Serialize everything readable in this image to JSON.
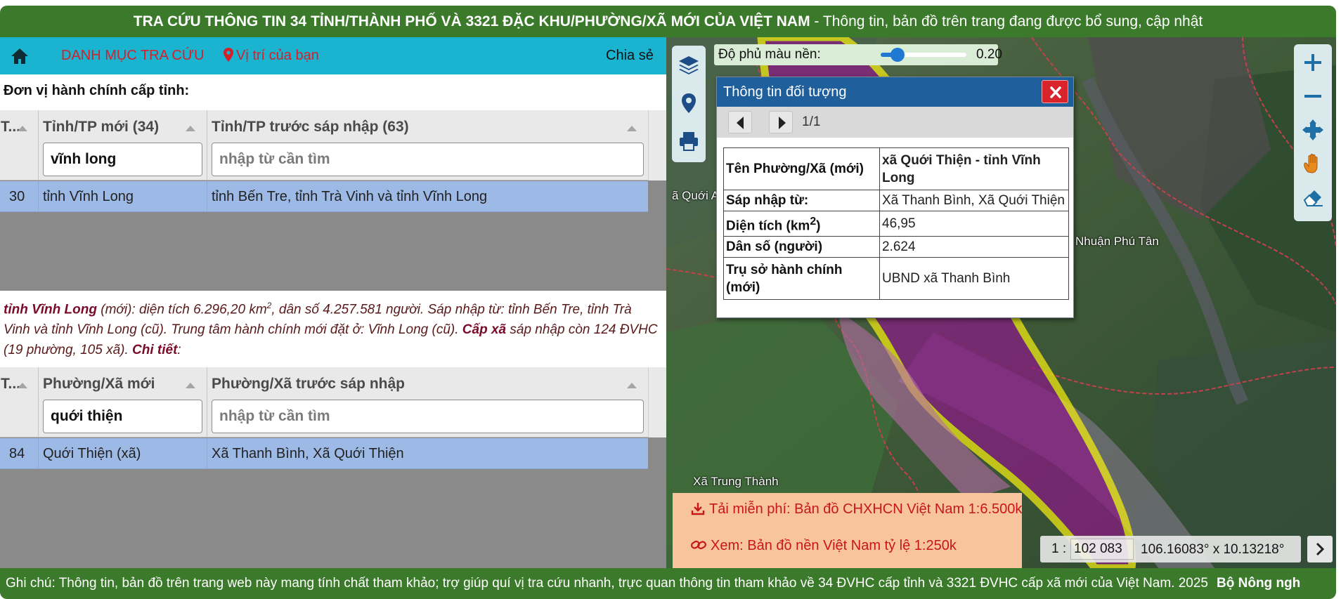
{
  "header": {
    "title": "TRA CỨU THÔNG TIN 34 TỈNH/THÀNH PHỐ VÀ 3321 ĐẶC KHU/PHƯỜNG/XÃ MỚI CỦA VIỆT NAM",
    "subtitle": " - Thông tin, bản đồ trên trang đang được bổ sung, cập nhật"
  },
  "nav": {
    "home_icon": "home-icon",
    "catalog": "DANH MỤC TRA CỨU",
    "location": "Vị trí của bạn",
    "share": "Chia sẻ"
  },
  "province_section": {
    "title": "Đơn vị hành chính cấp tỉnh:",
    "columns": [
      "T...",
      "Tỉnh/TP mới (34)",
      "Tỉnh/TP trước sáp nhập (63)"
    ],
    "filter_new_value": "vĩnh long",
    "filter_old_placeholder": "nhập từ cần tìm",
    "rows": [
      {
        "stt": "30",
        "new": "tỉnh Vĩnh Long",
        "old": "tỉnh Bến Tre, tỉnh Trà Vinh và tỉnh Vĩnh Long"
      }
    ]
  },
  "province_summary": {
    "name": "tỉnh Vĩnh Long",
    "text1": " (mới): diện tích 6.296,20 km",
    "sup": "2",
    "text2": ", dân số 4.257.581 người. Sáp nhập từ: tỉnh Bến Tre, tỉnh Trà Vinh và tỉnh Vĩnh Long (cũ). Trung tâm hành chính mới đặt ở: Vĩnh Long (cũ). ",
    "level_label": "Cấp xã",
    "text3": " sáp nhập còn 124 ĐVHC (19 phường, 105 xã). ",
    "detail_label": "Chi tiết",
    "text4": ":"
  },
  "commune_section": {
    "columns": [
      "T...",
      "Phường/Xã mới",
      "Phường/Xã trước sáp nhập"
    ],
    "filter_new_value": "quới thiện",
    "filter_old_placeholder": "nhập từ cần tìm",
    "rows": [
      {
        "stt": "84",
        "new": "Quới Thiện (xã)",
        "old": "Xã Thanh Bình, Xã Quới Thiện"
      }
    ]
  },
  "map": {
    "opacity_label": "Độ phủ màu nền:",
    "opacity_value": "0.20",
    "opacity_level": 0.2,
    "labels": [
      "ã Quới A",
      "Nhuận Phú Tân",
      "Xã Trung Thành"
    ],
    "left_tools": [
      "layers-icon",
      "map-pin-icon",
      "printer-icon"
    ],
    "right_tools": [
      "zoom-in-icon",
      "zoom-out-icon",
      "pan-arrows-icon",
      "hand-icon",
      "eraser-icon"
    ],
    "colors": {
      "highlight": "#8b1a86",
      "boundary": "#f5ee12",
      "admin_border": "#c3414a"
    }
  },
  "popup": {
    "title": "Thông tin đối tượng",
    "page": "1/1",
    "rows": [
      {
        "key": "Tên Phường/Xã (mới)",
        "value": "xã Quới Thiện - tỉnh Vĩnh Long"
      },
      {
        "key": "Sáp nhập từ:",
        "value": "Xã Thanh Bình, Xã Quới Thiện"
      },
      {
        "key": "Diện tích (km",
        "key_sup": "2",
        "key_tail": ")",
        "value": "46,95"
      },
      {
        "key": "Dân số (người)",
        "value": "2.624"
      },
      {
        "key": "Trụ sở hành chính (mới)",
        "value": "UBND xã Thanh Bình"
      }
    ]
  },
  "downloads": {
    "free": "Tải miễn phí: Bản đồ CHXHCN Việt Nam 1:6.500k",
    "view": "Xem: Bản đồ nền Việt Nam tỷ lệ 1:250k"
  },
  "scale": {
    "prefix": "1 :",
    "value": "102 083",
    "coords": "106.16083° x 10.13218°"
  },
  "footer": {
    "note": "Ghi chú: Thông tin, bản đồ trên trang web này mang tính chất tham khảo; trợ giúp quí vị tra cứu nhanh, trực quan thông tin tham khảo về 34 ĐVHC cấp tỉnh và 3321 ĐVHC cấp xã mới của Việt Nam. 2025",
    "org": "Bộ Nông ngh"
  }
}
